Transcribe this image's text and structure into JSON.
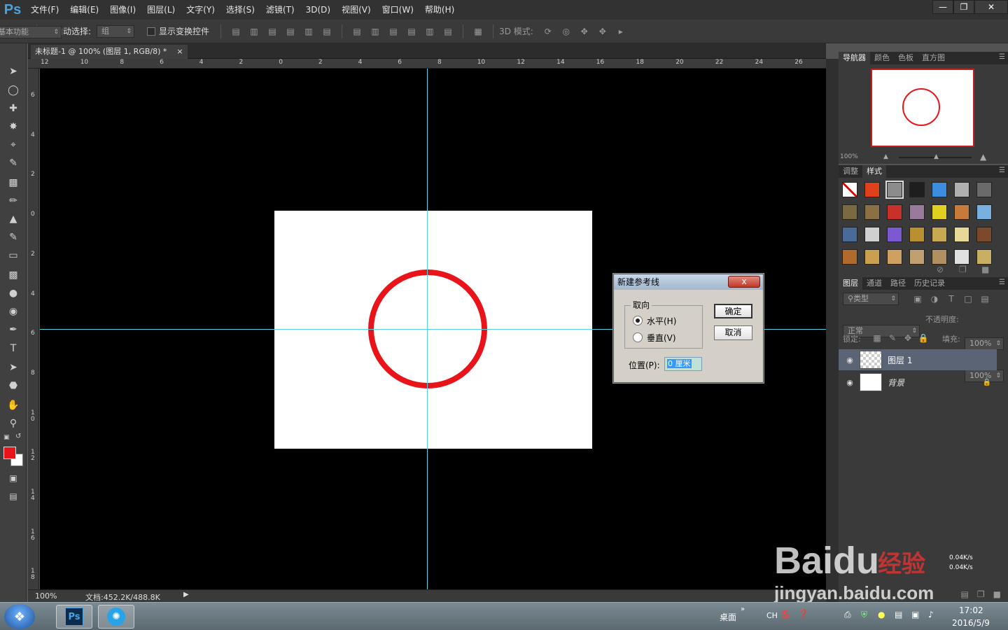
{
  "app": {
    "logo": "Ps"
  },
  "menubar": {
    "items": [
      "文件(F)",
      "编辑(E)",
      "图像(I)",
      "图层(L)",
      "文字(Y)",
      "选择(S)",
      "滤镜(T)",
      "3D(D)",
      "视图(V)",
      "窗口(W)",
      "帮助(H)"
    ]
  },
  "optionsbar": {
    "auto_select_label": "自动选择:",
    "auto_select_value": "组",
    "show_transform_label": "显示变换控件",
    "mode3d_label": "3D 模式:",
    "workspace": "基本功能"
  },
  "document": {
    "tab_title": "未标题-1 @ 100% (图层 1, RGB/8) *",
    "tab_close": "×",
    "ruler_h_labels": [
      "12",
      "10",
      "8",
      "6",
      "4",
      "2",
      "0",
      "2",
      "4",
      "6",
      "8",
      "10",
      "12",
      "14",
      "16",
      "18",
      "20",
      "22",
      "24",
      "26"
    ],
    "ruler_v_labels": [
      "6",
      "4",
      "2",
      "0",
      "2",
      "4",
      "6",
      "8",
      "10",
      "12",
      "14",
      "16",
      "18"
    ]
  },
  "statusbar": {
    "zoom": "100%",
    "doc_info": "文档:452.2K/488.8K"
  },
  "navigator": {
    "tabs": [
      "导航器",
      "颜色",
      "色板",
      "直方图"
    ],
    "zoom": "100%"
  },
  "styles_panel": {
    "tabs": [
      "调整",
      "样式"
    ],
    "swatch_colors": [
      "#ffffff",
      "#e0401a",
      "#8c8c8c",
      "#1e1e1e",
      "#3c8ce0",
      "#b0b0b0",
      "#6a6a6a",
      "#7b6a40",
      "#8a7044",
      "#c8302c",
      "#9a7a9c",
      "#e0d020",
      "#c87a3a",
      "#7ab0e0",
      "#4a6a9a",
      "#d0d0d0",
      "#7a5ad0",
      "#b89030",
      "#c8a850",
      "#e8d898",
      "#7a4a2a",
      "#b06a2a",
      "#c8a050",
      "#d0a060",
      "#c0a070",
      "#b09060",
      "#e0e0e0",
      "#c8b060"
    ]
  },
  "layers_panel": {
    "tabs": [
      "图层",
      "通道",
      "路径",
      "历史记录"
    ],
    "filter": "类型",
    "blend_mode": "正常",
    "opacity_label": "不透明度:",
    "opacity": "100%",
    "lock_label": "锁定:",
    "fill_label": "填充:",
    "fill": "100%",
    "layers": [
      {
        "name": "图层 1",
        "selected": true
      },
      {
        "name": "背景",
        "selected": false
      }
    ]
  },
  "dialog": {
    "title": "新建参考线",
    "close": "x",
    "orientation_label": "取向",
    "horizontal_label": "水平(H)",
    "vertical_label": "垂直(V)",
    "selected": "horizontal",
    "position_label": "位置(P):",
    "position_value": "0 厘米",
    "ok_label": "确定",
    "cancel_label": "取消"
  },
  "colors": {
    "foreground": "#e8141a",
    "background": "#ffffff",
    "circle": "#e8141a",
    "guide": "#5ad2e6"
  },
  "taskbar": {
    "desktop_label": "桌面",
    "lang": "CH",
    "time": "17:02",
    "date": "2016/5/9",
    "net_up": "0.04K/s",
    "net_down": "0.04K/s"
  },
  "watermark": {
    "brand": "Baidu",
    "brand_cn": "经验",
    "url": "jingyan.baidu.com"
  }
}
